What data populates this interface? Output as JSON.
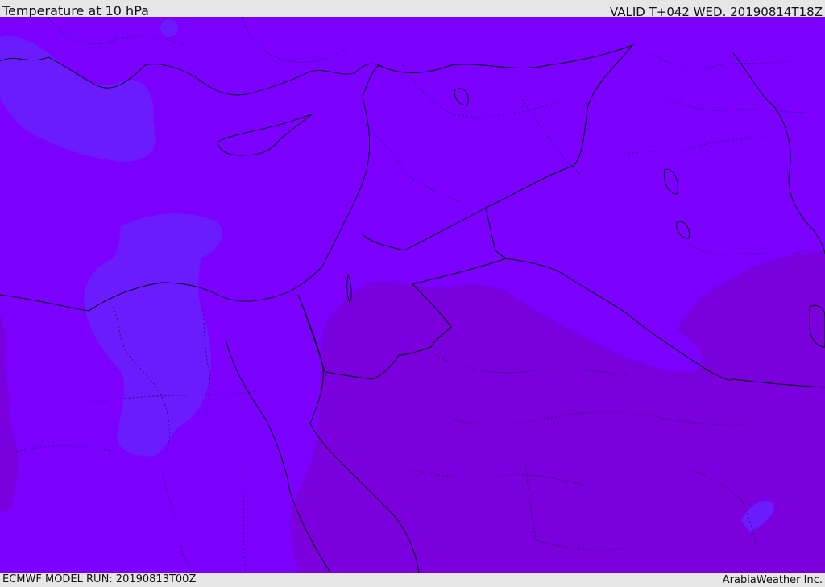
{
  "header": {
    "title": "Temperature at 10 hPa",
    "valid": "VALID T+042 WED. 20190814T18Z"
  },
  "footer": {
    "model_run": "ECMWF MODEL RUN: 20190813T00Z",
    "credit": "ArabiaWeather Inc."
  },
  "map": {
    "field": "temperature",
    "level": "10 hPa",
    "colors": {
      "base": "#7b00ff",
      "warm_zone": "#7a00de",
      "cool_zone": "#6a1cff",
      "coastline": "#000000"
    }
  }
}
